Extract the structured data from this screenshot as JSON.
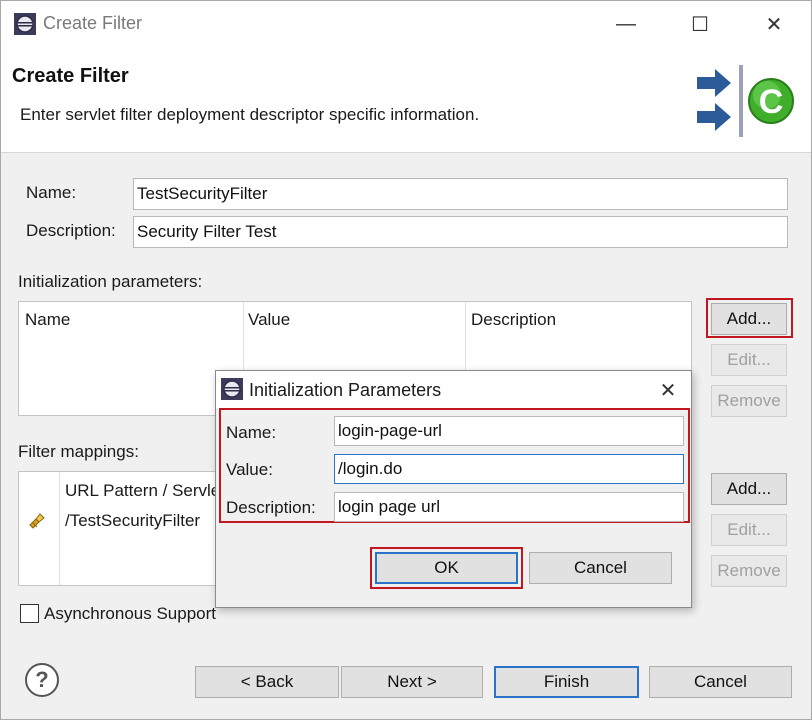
{
  "window": {
    "title": "Create Filter",
    "minimize_glyph": "—",
    "maximize_glyph": "☐",
    "close_glyph": "✕"
  },
  "header": {
    "title": "Create Filter",
    "description": "Enter servlet filter deployment descriptor specific information."
  },
  "form": {
    "name_label": "Name:",
    "name_value": "TestSecurityFilter",
    "description_label": "Description:",
    "description_value": "Security Filter Test"
  },
  "init_params": {
    "label": "Initialization parameters:",
    "columns": [
      "Name",
      "Value",
      "Description"
    ],
    "buttons": {
      "add": "Add...",
      "edit": "Edit...",
      "remove": "Remove"
    }
  },
  "filter_mappings": {
    "label": "Filter mappings:",
    "column_header": "URL Pattern / Servlet Name",
    "row_value": "/TestSecurityFilter",
    "buttons": {
      "add": "Add...",
      "edit": "Edit...",
      "remove": "Remove"
    }
  },
  "async": {
    "label": "Asynchronous Support",
    "checked": false
  },
  "footer": {
    "help_glyph": "?",
    "back": "< Back",
    "next": "Next >",
    "finish": "Finish",
    "cancel": "Cancel"
  },
  "dialog": {
    "title": "Initialization Parameters",
    "close_glyph": "✕",
    "name_label": "Name:",
    "name_value": "login-page-url",
    "value_label": "Value:",
    "value_value": "/login.do",
    "description_label": "Description:",
    "description_value": "login page url",
    "ok": "OK",
    "cancel": "Cancel"
  },
  "colors": {
    "highlight": "#c0181e",
    "focus": "#2a73c8",
    "dialog_bg": "#f0f0f0"
  }
}
